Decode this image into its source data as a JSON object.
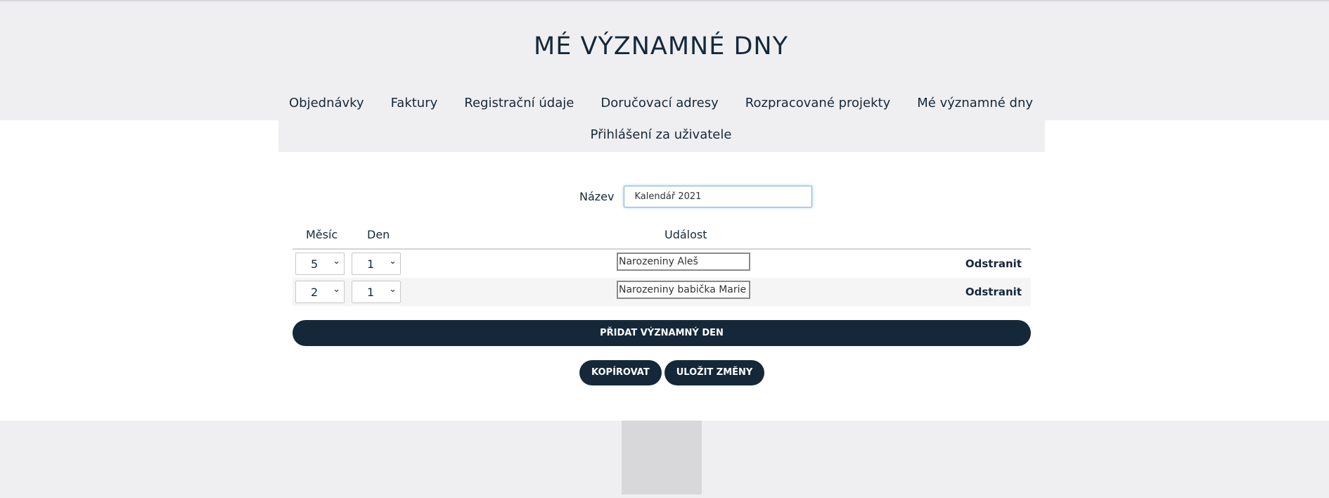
{
  "page": {
    "title": "MÉ VÝZNAMNÉ DNY"
  },
  "nav": {
    "items": [
      {
        "label": "Objednávky"
      },
      {
        "label": "Faktury"
      },
      {
        "label": "Registrační údaje"
      },
      {
        "label": "Doručovací adresy"
      },
      {
        "label": "Rozpracované projekty"
      },
      {
        "label": "Mé významné dny"
      },
      {
        "label": "Přihlášení za uživatele"
      }
    ]
  },
  "form": {
    "name_label": "Název",
    "name_value": "Kalendář 2021"
  },
  "table": {
    "headers": {
      "month": "Měsíc",
      "day": "Den",
      "event": "Událost"
    },
    "rows": [
      {
        "month": "5",
        "day": "1",
        "event": "Narozeniny Aleš",
        "remove": "Odstranit"
      },
      {
        "month": "2",
        "day": "1",
        "event": "Narozeniny babička Marie",
        "remove": "Odstranit"
      }
    ]
  },
  "actions": {
    "add_label": "PŘIDAT VÝZNAMNÝ DEN",
    "copy_label": "KOPÍROVAT",
    "save_label": "ULOŽIT ZMĚNY"
  },
  "icons": {
    "select_chevron": "chevron-down-icon"
  },
  "colors": {
    "primary": "#15283a",
    "page_bg": "#efeff1",
    "content_bg": "#ffffff",
    "focus_border": "#7fb4e3"
  }
}
